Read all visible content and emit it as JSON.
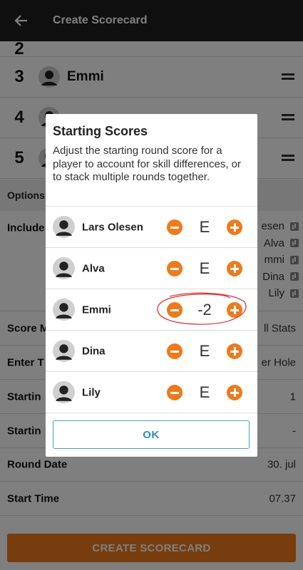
{
  "appbar": {
    "title": "Create Scorecard",
    "back_icon": "arrow-back-icon"
  },
  "players_list": [
    {
      "number": "2",
      "name": "",
      "partial": true
    },
    {
      "number": "3",
      "name": "Emmi"
    },
    {
      "number": "4",
      "name": ""
    },
    {
      "number": "5",
      "name": ""
    }
  ],
  "options": {
    "header": "Options",
    "include_label": "Include",
    "include_values": [
      "esen",
      "Alva",
      "mmi",
      "Dina",
      "Lily"
    ],
    "score_mode_label": "Score M",
    "score_mode_value": "ll Stats",
    "enter_label": "Enter T",
    "enter_value": "er Hole",
    "starting1_label": "Startin",
    "starting1_value": "1",
    "starting2_label": "Startin",
    "starting2_value": "-",
    "round_date_label": "Round Date",
    "round_date_value": "30. jul",
    "start_time_label": "Start Time",
    "start_time_value": "07.37"
  },
  "create_button": "CREATE SCORECARD",
  "dialog": {
    "title": "Starting Scores",
    "description": "Adjust the starting round score for a player to account for skill differences, or to stack multiple rounds together.",
    "players": [
      {
        "name": "Lars Olesen",
        "score": "E"
      },
      {
        "name": "Alva",
        "score": "E"
      },
      {
        "name": "Emmi",
        "score": "-2"
      },
      {
        "name": "Dina",
        "score": "E"
      },
      {
        "name": "Lily",
        "score": "E"
      }
    ],
    "ok_label": "OK"
  },
  "colors": {
    "accent": "#ee7a1c",
    "appbar": "#1f1f1f",
    "ok_blue": "#2f8fbf",
    "annotation": "#d9383a"
  }
}
